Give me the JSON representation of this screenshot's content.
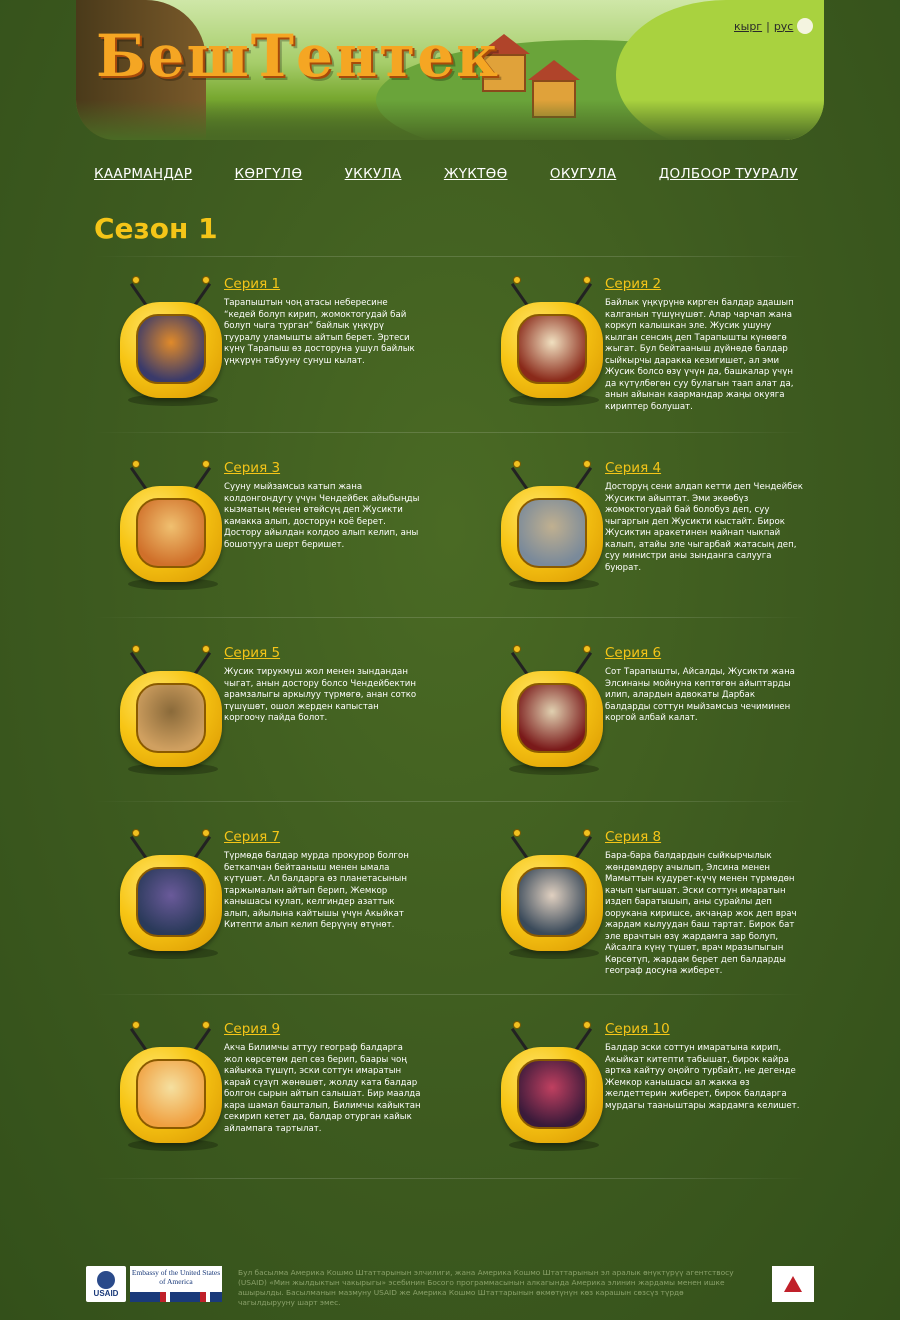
{
  "header": {
    "logo_text": "БешТентек",
    "lang": {
      "kg": "кырг",
      "sep": "|",
      "ru": "рус"
    }
  },
  "nav": [
    "КААРМАНДАР",
    "КӨРГҮЛӨ",
    "УККУЛА",
    "ЖҮКТӨӨ",
    "ОКУГУЛА",
    "ДОЛБООР ТУУРАЛУ"
  ],
  "season": {
    "title": "Сезон 1"
  },
  "episodes": [
    {
      "title": "Серия 1",
      "desc": "Тарапыштын чоң атасы небересине “кедей болуп кирип, жомоктогудай бай болуп чыга турган” байлык үңкүрү тууралу уламышты айтып берет. Эртеси күнү Тарапыш өз досторуна ушул байлык үңкүрүн табууну сунуш кылат.",
      "screen_colors": [
        "#3a3a6a",
        "#e08a2a"
      ]
    },
    {
      "title": "Серия 2",
      "desc": "Байлык үңкүрүнө кирген балдар адашып калганын түшүнүшөт. Алар чарчап жана коркуп калышкан эле. Жусик ушуну кылган сенсиң деп Тарапышты күнөөгө жыгат. Бул бейтааныш дүйнөдө балдар сыйкырчы даракка кезигишет, ал эми Жусик болсо өзү үчүн да, башкалар үчүн да күтүлбөгөн суу булагын таап алат да, анын айынан каармандар жаңы окуяга кириптер болушат.",
      "screen_colors": [
        "#8a2a1a",
        "#f0e0c0"
      ]
    },
    {
      "title": "Серия 3",
      "desc": "Сууну мыйзамсыз катып жана колдонгондугу үчүн Чендейбек айыбыңды кызматың менен өтөйсүң деп Жусикти камакка алып, досторун коё берет. Достору айылдан колдоо алып келип, аны бошотууга шерт беришет.",
      "screen_colors": [
        "#d0702a",
        "#f0c070"
      ]
    },
    {
      "title": "Серия 4",
      "desc": "Досторуң сени алдап кетти деп Чендейбек Жусикти айыптат. Эми экөөбүз жомоктогудай бай болобуз деп, суу чыгаргын деп Жусикти кыстайт. Бирок Жусиктин аракетинен майнап чыкпай калып, атайы эле чыгарбай жатасың деп, суу министри аны зынданга салууга буюрат.",
      "screen_colors": [
        "#7a8a9a",
        "#c0b090"
      ]
    },
    {
      "title": "Серия 5",
      "desc": "Жусик тирукмуш жол менен зындандан чыгат, анын достору болсо Чендейбектин арамзалыгы аркылуу түрмөгө, анан сотко түшүшөт, ошол жерден капыстан коргоочу пайда болот.",
      "screen_colors": [
        "#d0a060",
        "#8a6a3a"
      ]
    },
    {
      "title": "Серия 6",
      "desc": "Сот Тарапышты, Айсалды, Жусикти жана Элсинаны мойнуна көптөгөн айыптарды илип, алардын адвокаты Дарбак балдарды соттун мыйзамсыз чечиминен коргой албай калат.",
      "screen_colors": [
        "#7a1a1a",
        "#e0d0b0"
      ]
    },
    {
      "title": "Серия 7",
      "desc": "Түрмөдө балдар мурда прокурор болгон беткапчан бейтааныш менен ымала күтүшөт. Ал балдарга өз планетасынын таржымалын айтып берип, Жемкор канышасы кулап, келгиндер азаттык алып, айылына кайтышы үчүн Акыйкат Китепти алып келип берүүнү өтүнөт.",
      "screen_colors": [
        "#2a3a5a",
        "#6a5a9a"
      ]
    },
    {
      "title": "Серия 8",
      "desc": "Бара-бара балдардын сыйкырчылык жөндөмдөрү ачылып, Элсина менен Мамыттын кудурет-күчү менен түрмөдөн качып чыгышат. Эски соттун имаратын издеп баратышып, аны сурайлы деп оорукана киришсе, акчаңар жок деп врач жардам кылуудан баш тартат. Бирок бат эле врачтын өзү жардамга зар болуп, Айсалга күнү түшөт, врач мразыпыгын Көрсөтүп, жардам берет деп балдарды географ досуна жиберет.",
      "screen_colors": [
        "#3a4a5a",
        "#e0d0c0"
      ]
    },
    {
      "title": "Серия 9",
      "desc": "Акча Билимчы аттуу географ балдарга жол көрсөтөм деп сөз берип, баары чоң кайыкка түшүп, эски соттун имаратын карай сүзүп жөнөшөт, жолду ката балдар болгон сырын айтып салышат. Бир маалда кара шамал башталып, Билимчы кайыктан секирип кетет да, балдар отурган кайык айлампага тартылат.",
      "screen_colors": [
        "#f0a040",
        "#f5e0a0"
      ]
    },
    {
      "title": "Серия 10",
      "desc": "Балдар эски соттун имаратына кирип, Акыйкат китепти табышат, бирок кайра артка кайтуу оңойго турбайт, не дегенде Жемкор канышасы ал жакка өз желдеттерин жиберет, бирок балдарга мурдагы тааныштары жардамга келишет.",
      "screen_colors": [
        "#3a1a3a",
        "#c04060"
      ]
    }
  ],
  "footer": {
    "usaid": "USAID",
    "embassy": "Embassy of the United States of America",
    "text": "Бул басылма Америка Кошмо Штаттарынын элчилиги, жана Америка Кошмо Штаттарынын эл аралык өнүктүрүү агентствосу (USAID) «Мин жылдыктын чакырыгы» эсебинин Босого программасынын алкагында Америка элинин жардамы менен ишке ашырылды. Басылманын мазмуну USAID же Америка Кошмо Штаттарынын өкмөтүнүн көз карашын сөзсүз түрдө чагылдырууну шарт эмес."
  }
}
